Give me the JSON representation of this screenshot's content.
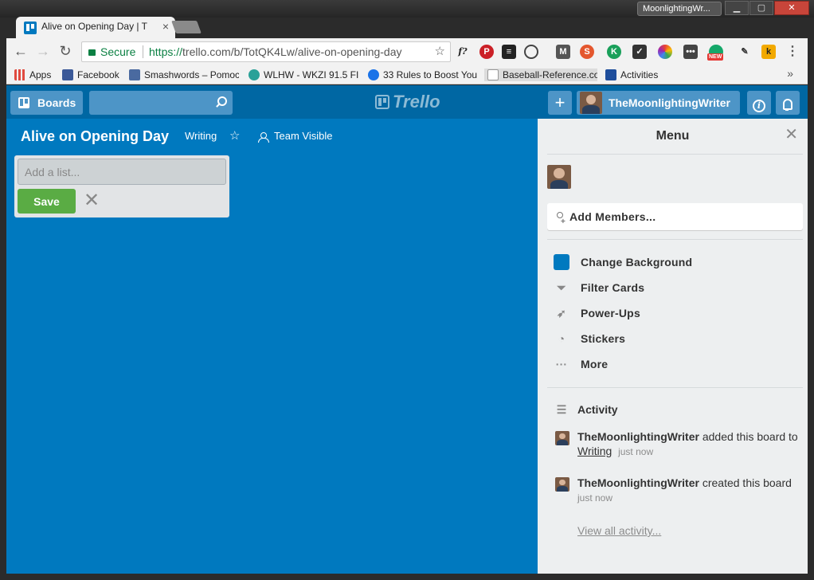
{
  "window": {
    "profile_name": "MoonlightingWr...",
    "btn_minimize": "▁",
    "btn_maximize": "▢",
    "btn_close": "✕"
  },
  "tab": {
    "title": "Alive on Opening Day | T",
    "close": "×"
  },
  "omnibox": {
    "secure_label": "Secure",
    "url_scheme": "https://",
    "url_rest": "trello.com/b/TotQK4Lw/alive-on-opening-day"
  },
  "extensions": {
    "f_label": "f?",
    "new_badge": "NEW",
    "k_label": "k",
    "menu_dots": "⋮"
  },
  "bookmarks": [
    {
      "label": "Apps",
      "color": "#e04a3f"
    },
    {
      "label": "Facebook",
      "color": "#3b5998"
    },
    {
      "label": "Smashwords – Pomoc",
      "color": "#4a6aa0"
    },
    {
      "label": "WLHW - WKZI 91.5 FI",
      "color": "#2aa198"
    },
    {
      "label": "33 Rules to Boost You",
      "color": "#1a73e8"
    },
    {
      "label": "Baseball-Reference.co",
      "color": "#999999"
    },
    {
      "label": "Activities",
      "color": "#1f4e9c"
    }
  ],
  "bookmarks_more": "»",
  "trello": {
    "boards_label": "Boards",
    "logo_text": "Trello",
    "plus_label": "+",
    "username": "TheMoonlightingWriter",
    "info_label": "i",
    "board_title": "Alive on Opening Day",
    "board_tag": "Writing",
    "board_visibility": "Team Visible",
    "add_list_placeholder": "Add a list...",
    "save_label": "Save",
    "cancel_label": "✕",
    "accent_color": "#0079bf",
    "save_color": "#5aac44"
  },
  "menu": {
    "title": "Menu",
    "close": "✕",
    "add_members": "Add Members...",
    "items": [
      {
        "label": "Change Background",
        "icon": "background-swatch"
      },
      {
        "label": "Filter Cards",
        "icon": "filter-icon"
      },
      {
        "label": "Power-Ups",
        "icon": "rocket-icon"
      },
      {
        "label": "Stickers",
        "icon": "sticker-icon"
      },
      {
        "label": "More",
        "icon": "more-icon"
      }
    ],
    "activity_title": "Activity",
    "activity": [
      {
        "who": "TheMoonlightingWriter",
        "action": " added this board to ",
        "link": "Writing",
        "when": "just now"
      },
      {
        "who": "TheMoonlightingWriter",
        "action": " created this board",
        "when": "just now"
      }
    ],
    "view_all": "View all activity..."
  }
}
